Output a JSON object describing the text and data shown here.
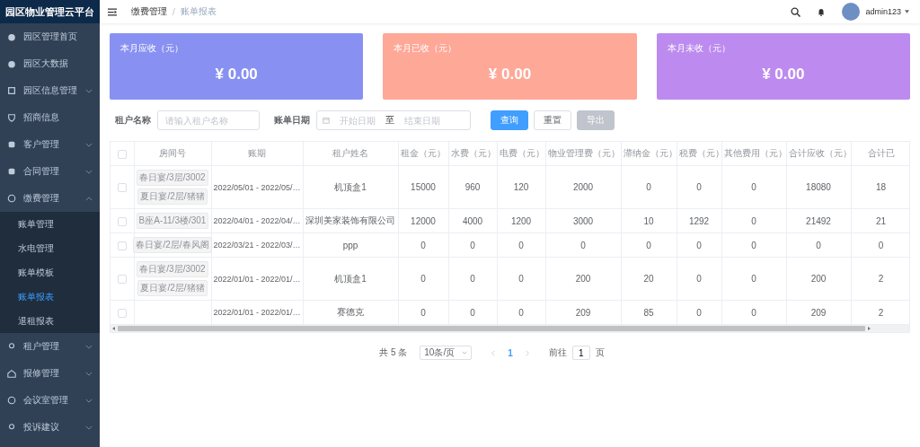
{
  "sidebar": {
    "title": "园区物业管理云平台",
    "items": [
      {
        "label": "园区管理首页"
      },
      {
        "label": "园区大数据"
      },
      {
        "label": "园区信息管理",
        "expanded": false
      },
      {
        "label": "招商信息"
      },
      {
        "label": "客户管理",
        "expanded": false
      },
      {
        "label": "合同管理",
        "expanded": false
      },
      {
        "label": "缴费管理",
        "expanded": true,
        "children": [
          {
            "label": "账单管理",
            "selected": false
          },
          {
            "label": "水电管理",
            "selected": false
          },
          {
            "label": "账单模板",
            "selected": false
          },
          {
            "label": "账单报表",
            "selected": true
          },
          {
            "label": "退租报表",
            "selected": false
          }
        ]
      },
      {
        "label": "租户管理",
        "expanded": false
      },
      {
        "label": "报修管理",
        "expanded": false
      },
      {
        "label": "会议室管理",
        "expanded": false
      },
      {
        "label": "投诉建议",
        "expanded": false
      }
    ]
  },
  "header": {
    "breadcrumb": [
      "缴费管理",
      "账单报表"
    ],
    "breadcrumb_separator": "/",
    "user": "admin123"
  },
  "cards": [
    {
      "title": "本月应收（元）",
      "amount": "¥ 0.00",
      "color": "#8891f2"
    },
    {
      "title": "本月已收（元）",
      "amount": "¥ 0.00",
      "color": "#fea898"
    },
    {
      "title": "本月未收（元）",
      "amount": "¥ 0.00",
      "color": "#bd8bef"
    }
  ],
  "filters": {
    "tenant_label": "租户名称",
    "tenant_placeholder": "请输入租户名称",
    "date_label": "账单日期",
    "start_placeholder": "开始日期",
    "separator": "至",
    "end_placeholder": "结束日期",
    "buttons": [
      {
        "label": "查询",
        "kind": "primary",
        "disabled": false
      },
      {
        "label": "重置",
        "kind": "default",
        "disabled": false
      },
      {
        "label": "导出",
        "kind": "default",
        "disabled": true
      }
    ]
  },
  "table": {
    "all_checked": false,
    "columns": [
      "房间号",
      "账期",
      "租户姓名",
      "租金（元）",
      "水费（元）",
      "电费（元）",
      "物业管理费（元）",
      "滞纳金（元）",
      "税费（元）",
      "其他费用（元）",
      "合计应收（元）",
      "合计已"
    ],
    "rows": [
      {
        "checked": false,
        "cells": [
          [
            "春日宴/3层/3002",
            "夏日宴/2层/猪猪"
          ],
          "2022/05/01 - 2022/05/…",
          "机顶盒1",
          "15000",
          "960",
          "120",
          "2000",
          "0",
          "0",
          "0",
          "18080",
          "18"
        ]
      },
      {
        "checked": false,
        "cells": [
          [
            "B座A-11/3楼/301"
          ],
          "2022/04/01 - 2022/04/…",
          "深圳美家装饰有限公司",
          "12000",
          "4000",
          "1200",
          "3000",
          "10",
          "1292",
          "0",
          "21492",
          "21"
        ]
      },
      {
        "checked": false,
        "cells": [
          [
            "春日宴/2层/春风阁"
          ],
          "2022/03/21 - 2022/03/…",
          "ppp",
          "0",
          "0",
          "0",
          "0",
          "0",
          "0",
          "0",
          "0",
          "0"
        ]
      },
      {
        "checked": false,
        "cells": [
          [
            "春日宴/3层/3002",
            "夏日宴/2层/猪猪"
          ],
          "2022/01/01 - 2022/01/…",
          "机顶盒1",
          "0",
          "0",
          "0",
          "200",
          "20",
          "0",
          "0",
          "200",
          "2"
        ]
      },
      {
        "checked": false,
        "cells": [
          "",
          "2022/01/01 - 2022/01/…",
          "赛德克",
          "0",
          "0",
          "0",
          "209",
          "85",
          "0",
          "0",
          "209",
          "2"
        ]
      }
    ]
  },
  "pagination": {
    "total": "共 5 条",
    "page_size": "10条/页",
    "pages": [
      {
        "label": "1",
        "selected": true
      }
    ],
    "goto_label": "前往",
    "goto_value": "1",
    "page_label": "页"
  }
}
